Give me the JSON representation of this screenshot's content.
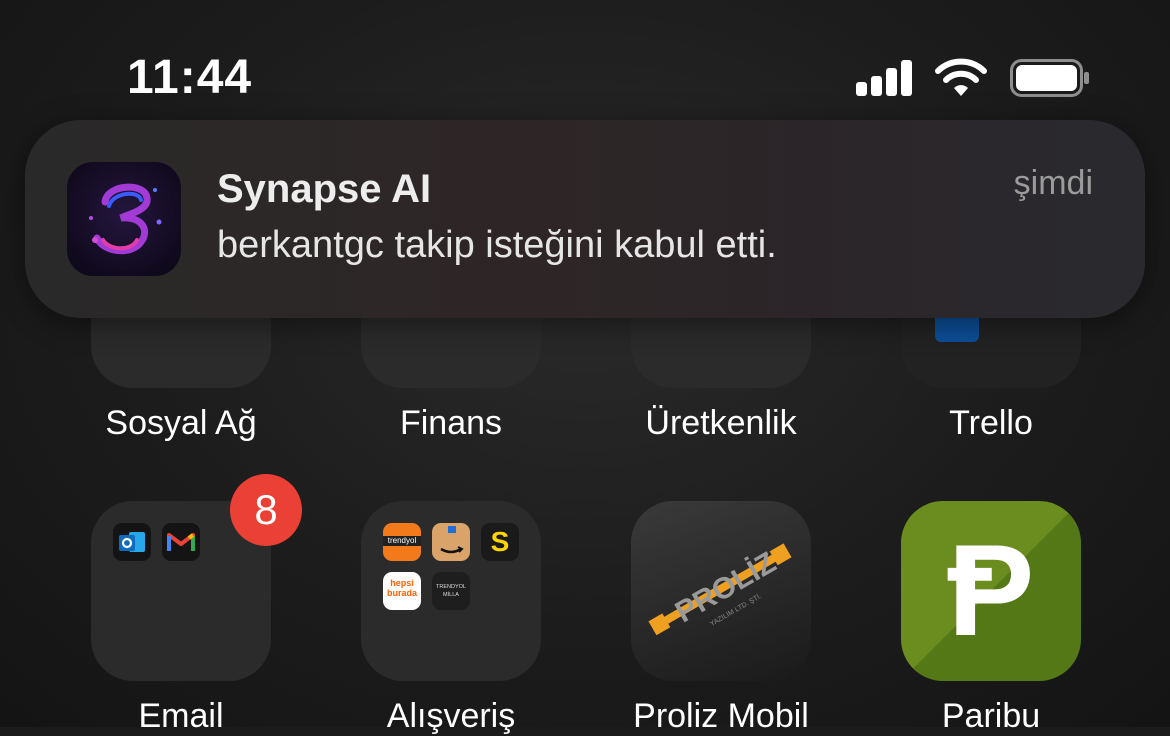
{
  "status_bar": {
    "time": "11:44"
  },
  "notification": {
    "app_name": "Synapse AI",
    "message": "berkantgc takip isteğini kabul etti.",
    "time": "şimdi",
    "icon": "synapse-logo-icon"
  },
  "home": {
    "row1": [
      {
        "label": "Sosyal Ağ"
      },
      {
        "label": "Finans"
      },
      {
        "label": "Üretkenlik"
      },
      {
        "label": "Trello"
      }
    ],
    "row2": [
      {
        "label": "Email",
        "badge": "8"
      },
      {
        "label": "Alışveriş"
      },
      {
        "label": "Proliz Mobil"
      },
      {
        "label": "Paribu"
      }
    ],
    "shopping_folder_apps": [
      {
        "name": "trendyol",
        "text": "trendyol"
      },
      {
        "name": "amazon"
      },
      {
        "name": "s-app",
        "text": "S"
      },
      {
        "name": "hepsiburada",
        "text": "hepsi\nburada"
      },
      {
        "name": "trendyol-milla",
        "text": "TRENDYOL\nMİLLA"
      }
    ],
    "email_folder_apps": [
      {
        "name": "outlook"
      },
      {
        "name": "gmail"
      }
    ],
    "proliz_logo_text": "PROLİZ",
    "proliz_logo_subtext": "YAZILIM LTD. ŞTİ.",
    "paribu_glyph": "Ᵽ"
  },
  "colors": {
    "badge": "#eb4035",
    "paribu_green": "#6b8d1f",
    "proliz_orange": "#f0a020"
  }
}
